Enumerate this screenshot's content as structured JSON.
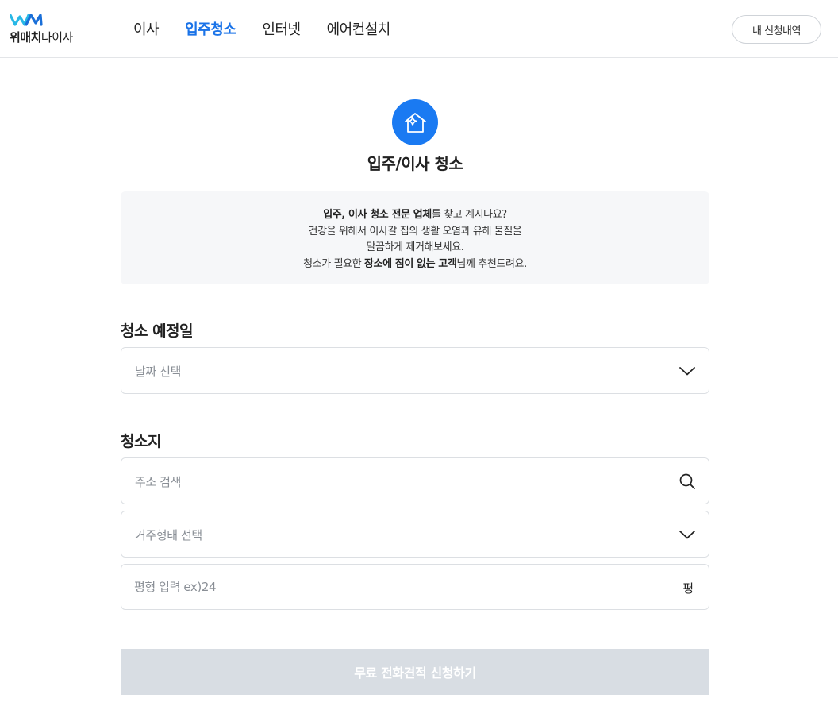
{
  "header": {
    "logo_bold": "위매치",
    "logo_regular": "다이사",
    "nav": [
      {
        "label": "이사"
      },
      {
        "label": "입주청소"
      },
      {
        "label": "인터넷"
      },
      {
        "label": "에어컨설치"
      }
    ],
    "active_nav": "입주청소",
    "my_requests_label": "내 신청내역"
  },
  "service": {
    "icon": "sparkle-house-icon",
    "title": "입주/이사 청소"
  },
  "info": {
    "line1_bold": "입주, 이사 청소 전문 업체",
    "line1_rest": "를 찾고 계시나요?",
    "line2": "건강을 위해서 이사갈 집의 생활 오염과 유해 물질을",
    "line3": "말끔하게 제거해보세요.",
    "line4_pre": "청소가 필요한 ",
    "line4_bold": "장소에 짐이 없는 고객",
    "line4_post": "님께 추천드려요."
  },
  "schedule": {
    "label": "청소 예정일",
    "date_placeholder": "날짜 선택"
  },
  "location": {
    "label": "청소지",
    "address_placeholder": "주소 검색",
    "residence_placeholder": "거주형태 선택",
    "size_placeholder": "평형 입력 ex)24",
    "size_unit": "평"
  },
  "submit_label": "무료 전화견적 신청하기",
  "colors": {
    "accent": "#1a73e8",
    "icon_bg": "#1a7af2",
    "logo_cyan": "#28b8e6",
    "logo_blue": "#1a6fd8",
    "info_bg": "#f6f7f9",
    "submit_disabled": "#d8dde3"
  }
}
